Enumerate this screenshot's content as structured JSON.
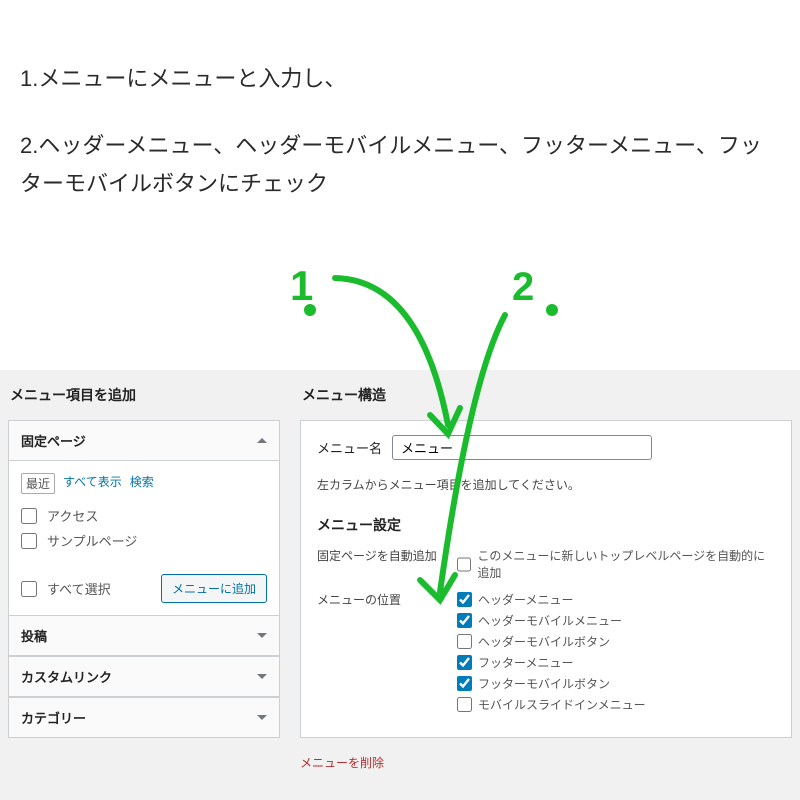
{
  "instructions": {
    "line1": "1.メニューにメニューと入力し、",
    "line2": "2.ヘッダーメニュー、ヘッダーモバイルメニュー、フッターメニュー、フッターモバイルボタンにチェック"
  },
  "annotation": {
    "marker1": "1.",
    "marker2": "2."
  },
  "left": {
    "title": "メニュー項目を追加",
    "panels": {
      "fixed_page": "固定ページ",
      "posts": "投稿",
      "custom_link": "カスタムリンク",
      "category": "カテゴリー"
    },
    "tabs": {
      "recent": "最近",
      "show_all": "すべて表示",
      "search": "検索"
    },
    "items": {
      "access": "アクセス",
      "sample_page": "サンプルページ"
    },
    "select_all": "すべて選択",
    "add_button": "メニューに追加"
  },
  "right": {
    "title": "メニュー構造",
    "menu_name_label": "メニュー名",
    "menu_name_value": "メニュー",
    "help_text": "左カラムからメニュー項目を追加してください。",
    "settings_title": "メニュー設定",
    "auto_add_label": "固定ページを自動追加",
    "auto_add_option": "このメニューに新しいトップレベルページを自動的に追加",
    "position_label": "メニューの位置",
    "positions": {
      "header_menu": "ヘッダーメニュー",
      "header_mobile_menu": "ヘッダーモバイルメニュー",
      "header_mobile_buttons": "ヘッダーモバイルボタン",
      "footer_menu": "フッターメニュー",
      "footer_mobile_buttons": "フッターモバイルボタン",
      "mobile_slidein_menu": "モバイルスライドインメニュー"
    },
    "delete_link": "メニューを削除"
  }
}
